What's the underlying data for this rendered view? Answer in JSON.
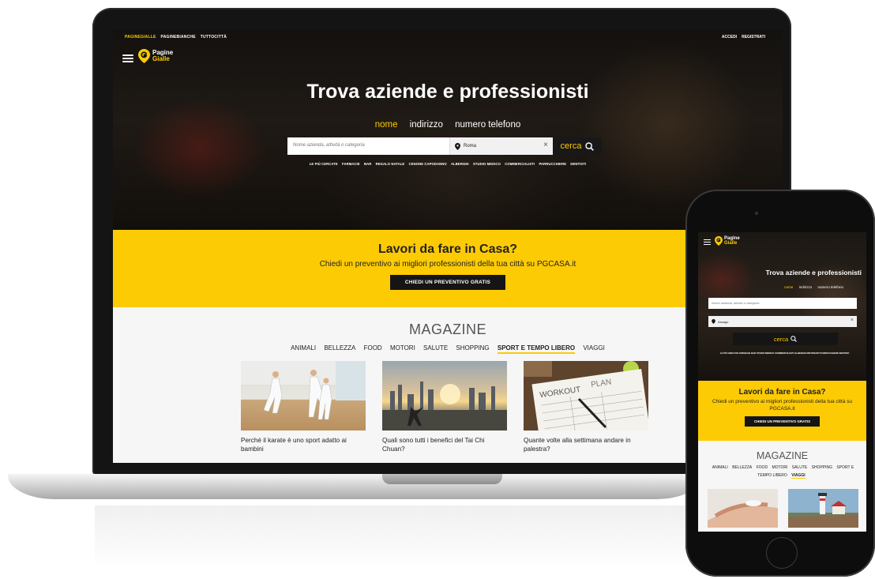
{
  "site": {
    "logo_line1": "Pagine",
    "logo_line2": "Gialle",
    "topnav": [
      "PAGINEGIALLE",
      "PAGINEBIANCHE",
      "TUTTOCITTÀ"
    ],
    "auth": {
      "login": "ACCEDI",
      "register": "REGISTRATI"
    }
  },
  "hero": {
    "title": "Trova aziende e professionisti",
    "tabs": [
      {
        "label": "nome",
        "active": true
      },
      {
        "label": "indirizzo",
        "active": false
      },
      {
        "label": "numero telefono",
        "active": false
      }
    ],
    "search": {
      "what_placeholder": "Nome azienda, attività o categoria",
      "where_value": "Roma",
      "where_value_mobile": "Assago",
      "button_label": "cerca"
    },
    "popular": [
      "LE PIÙ CERCATE",
      "FARMACIE",
      "BAR",
      "REGALO NATALE",
      "CENONE CAPODANNO",
      "ALBERGHI",
      "STUDIO MEDICO",
      "COMMERCIALISTI",
      "PARRUCCHIERE",
      "DENTISTI"
    ],
    "popular_mobile": "LE PIÙ CERCATE  FARMACIE  BAR  STUDIO MEDICO  COMMERCIALISTI  ALBERGHI  RISTORANTI  PARRUCCHIERE  DENTISTI"
  },
  "promo": {
    "title": "Lavori da fare in Casa?",
    "text": "Chiedi un preventivo ai migliori professionisti della tua città su PGCASA.it",
    "cta": "CHIEDI UN PREVENTIVO GRATIS"
  },
  "magazine": {
    "title": "MAGAZINE",
    "categories": [
      {
        "label": "ANIMALI",
        "active": false
      },
      {
        "label": "BELLEZZA",
        "active": false
      },
      {
        "label": "FOOD",
        "active": false
      },
      {
        "label": "MOTORI",
        "active": false
      },
      {
        "label": "SALUTE",
        "active": false
      },
      {
        "label": "SHOPPING",
        "active": false
      },
      {
        "label": "SPORT E TEMPO LIBERO",
        "active": true
      },
      {
        "label": "VIAGGI",
        "active": false
      }
    ],
    "articles": [
      {
        "caption": "Perché il karate è uno sport adatto ai bambini"
      },
      {
        "caption": "Quali sono tutti i benefici del Tai Chi Chuan?"
      },
      {
        "caption": "Quante volte alla settimana andare in palestra?"
      }
    ],
    "mobile_active_category": "VIAGGI"
  },
  "colors": {
    "brand_yellow": "#fdcb04",
    "accent_yellow": "#ffcc00",
    "dark": "#151515"
  },
  "icons": [
    "menu-icon",
    "location-pin-icon",
    "clear-icon",
    "search-icon"
  ]
}
